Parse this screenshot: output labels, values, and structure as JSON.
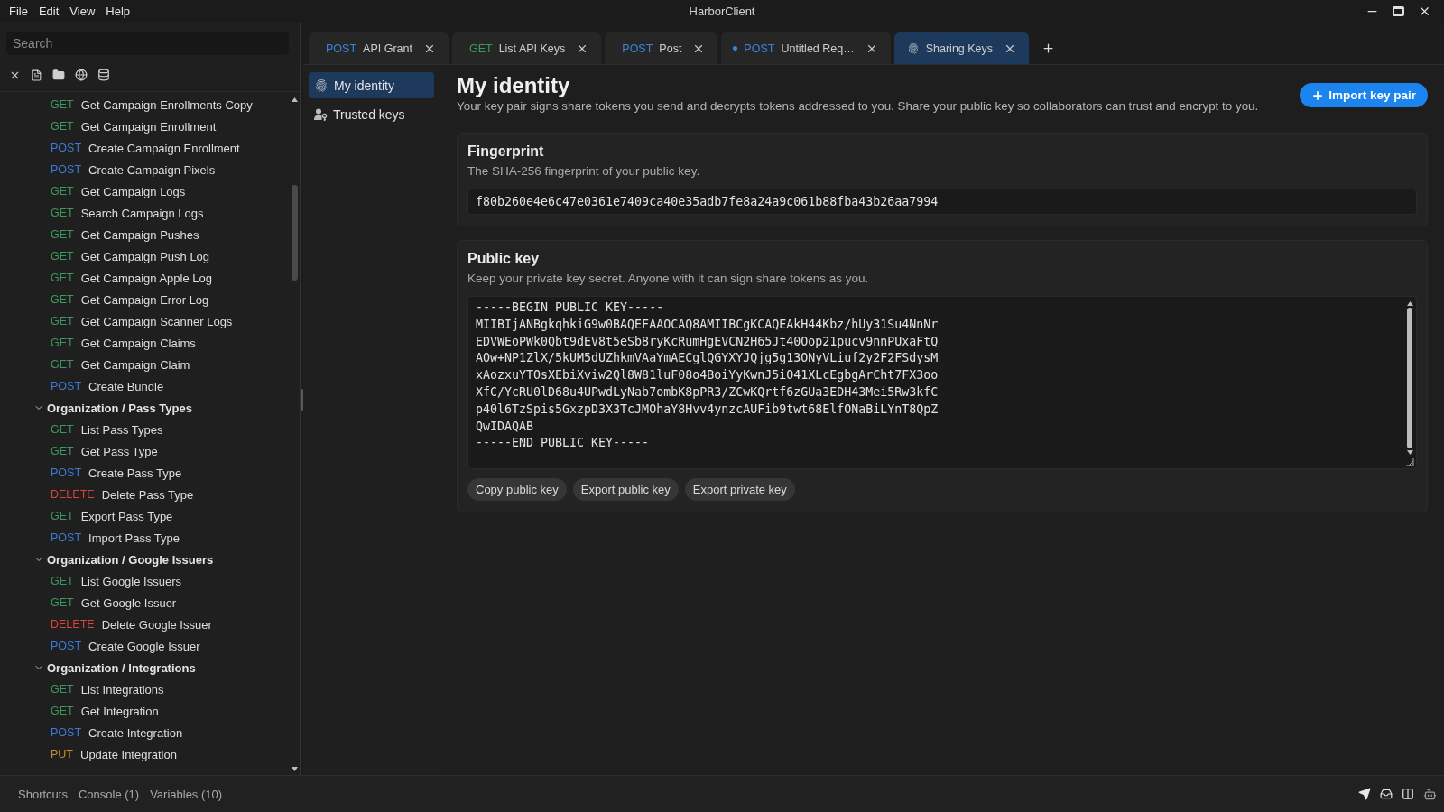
{
  "window": {
    "title": "HarborClient"
  },
  "menu": [
    "File",
    "Edit",
    "View",
    "Help"
  ],
  "sidebar": {
    "search": {
      "placeholder": "Search"
    },
    "groups": [
      {
        "children": [
          {
            "method": "GET",
            "color": "#3c9a5f",
            "label": "Get Campaign Enrollments Copy"
          },
          {
            "method": "GET",
            "color": "#3c9a5f",
            "label": "Get Campaign Enrollment"
          },
          {
            "method": "POST",
            "color": "#3a7bd5",
            "label": "Create Campaign Enrollment"
          },
          {
            "method": "POST",
            "color": "#3a7bd5",
            "label": "Create Campaign Pixels"
          },
          {
            "method": "GET",
            "color": "#3c9a5f",
            "label": "Get Campaign Logs"
          },
          {
            "method": "GET",
            "color": "#3c9a5f",
            "label": "Search Campaign Logs"
          },
          {
            "method": "GET",
            "color": "#3c9a5f",
            "label": "Get Campaign Pushes"
          },
          {
            "method": "GET",
            "color": "#3c9a5f",
            "label": "Get Campaign Push Log"
          },
          {
            "method": "GET",
            "color": "#3c9a5f",
            "label": "Get Campaign Apple Log"
          },
          {
            "method": "GET",
            "color": "#3c9a5f",
            "label": "Get Campaign Error Log"
          },
          {
            "method": "GET",
            "color": "#3c9a5f",
            "label": "Get Campaign Scanner Logs"
          },
          {
            "method": "GET",
            "color": "#3c9a5f",
            "label": "Get Campaign Claims"
          },
          {
            "method": "GET",
            "color": "#3c9a5f",
            "label": "Get Campaign Claim"
          },
          {
            "method": "POST",
            "color": "#3a7bd5",
            "label": "Create Bundle"
          }
        ]
      },
      {
        "label": "Organization / Pass Types",
        "expanded": true,
        "children": [
          {
            "method": "GET",
            "color": "#3c9a5f",
            "label": "List Pass Types"
          },
          {
            "method": "GET",
            "color": "#3c9a5f",
            "label": "Get Pass Type"
          },
          {
            "method": "POST",
            "color": "#3a7bd5",
            "label": "Create Pass Type"
          },
          {
            "method": "DELETE",
            "color": "#d9453d",
            "label": "Delete Pass Type"
          },
          {
            "method": "GET",
            "color": "#3c9a5f",
            "label": "Export Pass Type"
          },
          {
            "method": "POST",
            "color": "#3a7bd5",
            "label": "Import Pass Type"
          }
        ]
      },
      {
        "label": "Organization / Google Issuers",
        "expanded": true,
        "children": [
          {
            "method": "GET",
            "color": "#3c9a5f",
            "label": "List Google Issuers"
          },
          {
            "method": "GET",
            "color": "#3c9a5f",
            "label": "Get Google Issuer"
          },
          {
            "method": "DELETE",
            "color": "#d9453d",
            "label": "Delete Google Issuer"
          },
          {
            "method": "POST",
            "color": "#3a7bd5",
            "label": "Create Google Issuer"
          }
        ]
      },
      {
        "label": "Organization / Integrations",
        "expanded": true,
        "children": [
          {
            "method": "GET",
            "color": "#3c9a5f",
            "label": "List Integrations"
          },
          {
            "method": "GET",
            "color": "#3c9a5f",
            "label": "Get Integration"
          },
          {
            "method": "POST",
            "color": "#3a7bd5",
            "label": "Create Integration"
          },
          {
            "method": "PUT",
            "color": "#c98b2b",
            "label": "Update Integration"
          }
        ]
      }
    ]
  },
  "tabs": [
    {
      "kind": "request",
      "method": "POST",
      "color": "#3a82dc",
      "label": "API Grant",
      "selected": false,
      "unsaved": false
    },
    {
      "kind": "request",
      "method": "GET",
      "color": "#3c9a5f",
      "label": "List API Keys",
      "selected": false,
      "unsaved": false
    },
    {
      "kind": "request",
      "method": "POST",
      "color": "#3a82dc",
      "label": "Post",
      "selected": false,
      "unsaved": false
    },
    {
      "kind": "request",
      "method": "POST",
      "color": "#3a82dc",
      "label": "Untitled Req…",
      "selected": false,
      "unsaved": true
    },
    {
      "kind": "keys",
      "label": "Sharing Keys",
      "selected": true,
      "unsaved": false
    }
  ],
  "subnav": [
    {
      "kind": "identity",
      "label": "My identity",
      "selected": true
    },
    {
      "kind": "trusted",
      "label": "Trusted keys",
      "selected": false
    }
  ],
  "page": {
    "title": "My identity",
    "description": "Your key pair signs share tokens you send and decrypts tokens addressed to you. Share your public key so collaborators can trust and encrypt to you.",
    "import_button": "Import key pair"
  },
  "fingerprint_card": {
    "title": "Fingerprint",
    "subtitle": "The SHA-256 fingerprint of your public key.",
    "value": "f80b260e4e6c47e0361e7409ca40e35adb7fe8a24a9c061b88fba43b26aa7994"
  },
  "public_key_card": {
    "title": "Public key",
    "subtitle": "Keep your private key secret. Anyone with it can sign share tokens as you.",
    "value": "-----BEGIN PUBLIC KEY-----\nMIIBIjANBgkqhkiG9w0BAQEFAAOCAQ8AMIIBCgKCAQEAkH44Kbz/hUy31Su4NnNr\nEDVWEoPWk0Qbt9dEV8t5eSb8ryKcRumHgEVCN2H65Jt40Oop21pucv9nnPUxaFtQ\nAOw+NP1ZlX/5kUM5dUZhkmVAaYmAECglQGYXYJQjg5g13ONyVLiuf2y2F2FSdysM\nxAozxuYTOsXEbiXviw2Ql8W81luF08o4BoiYyKwnJ5iO41XLcEgbgArCht7FX3oo\nXfC/YcRU0lD68u4UPwdLyNab7ombK8pPR3/ZCwKQrtf6zGUa3EDH43Mei5Rw3kfC\np40l6TzSpis5GxzpD3X3TcJMOhaY8Hvv4ynzcAUFib9twt68ElfONaBiLYnT8QpZ\nQwIDAQAB\n-----END PUBLIC KEY-----",
    "buttons": [
      "Copy public key",
      "Export public key",
      "Export private key"
    ]
  },
  "status_bar": {
    "items": [
      "Shortcuts",
      "Console (1)",
      "Variables (10)"
    ]
  }
}
